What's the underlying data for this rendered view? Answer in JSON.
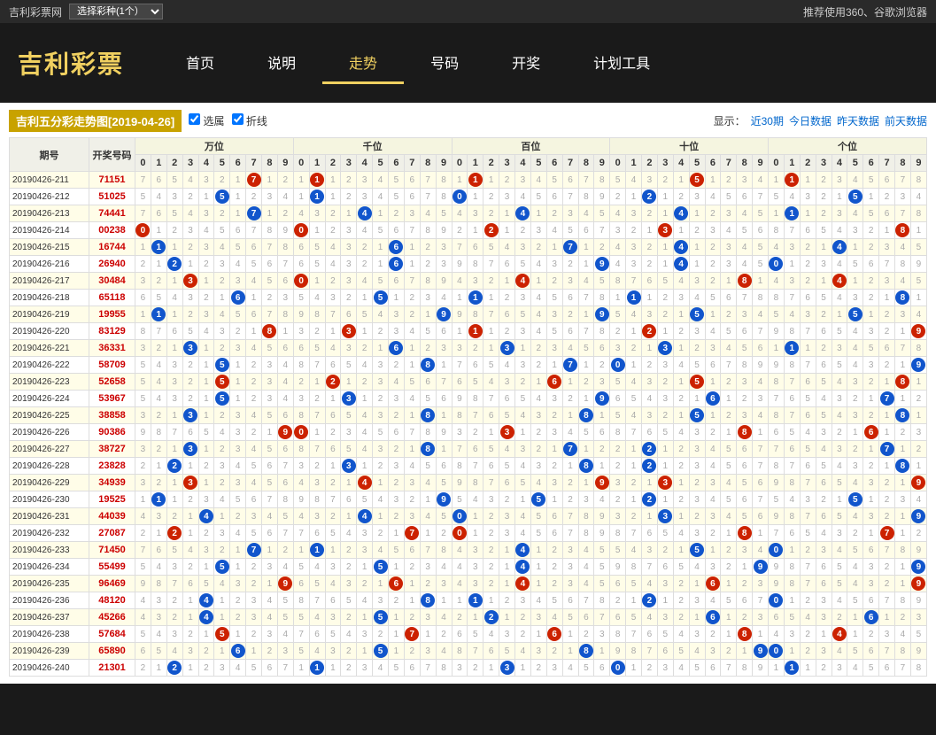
{
  "topbar": {
    "site_link": "吉利彩票网",
    "select_label": "选择彩种(1个）",
    "recommend": "推荐使用360、谷歌浏览器"
  },
  "header": {
    "logo_main": "吉利彩票",
    "nav_items": [
      {
        "label": "首页",
        "active": false
      },
      {
        "label": "说明",
        "active": false
      },
      {
        "label": "走势",
        "active": true
      },
      {
        "label": "号码",
        "active": false
      },
      {
        "label": "开奖",
        "active": false
      },
      {
        "label": "计划工具",
        "active": false
      }
    ]
  },
  "chart": {
    "title": "吉利五分彩走势图[2019-04-26]",
    "checkbox_xuanzhu": "选属",
    "checkbox_zhexian": "折线",
    "display_label": "显示：",
    "links": [
      "近30期",
      "今日数据",
      "昨天数据",
      "前天数据"
    ]
  },
  "table": {
    "headers": {
      "qihao": "期号",
      "kajiang": "开奖号码",
      "wan": "万位",
      "qian": "千位",
      "bai": "百位",
      "shi": "十位",
      "ge": "个位"
    },
    "digits": [
      "0",
      "1",
      "2",
      "3",
      "4",
      "5",
      "6",
      "7",
      "8",
      "9"
    ],
    "rows": [
      {
        "qihao": "20190426-211",
        "kajiang": "71151",
        "wan": "7",
        "qian": "1",
        "bai": "1",
        "shi": "5",
        "ge": "1"
      },
      {
        "qihao": "20190426-212",
        "kajiang": "51025",
        "wan": "5",
        "qian": "1",
        "bai": "0",
        "shi": "2",
        "ge": "5"
      },
      {
        "qihao": "20190426-213",
        "kajiang": "74441",
        "wan": "7",
        "qian": "4",
        "bai": "4",
        "shi": "4",
        "ge": "1"
      },
      {
        "qihao": "20190426-214",
        "kajiang": "00238",
        "wan": "0",
        "qian": "0",
        "bai": "2",
        "shi": "3",
        "ge": "8"
      },
      {
        "qihao": "20190426-215",
        "kajiang": "16744",
        "wan": "1",
        "qian": "6",
        "bai": "7",
        "shi": "4",
        "ge": "4"
      },
      {
        "qihao": "20190426-216",
        "kajiang": "26940",
        "wan": "2",
        "qian": "6",
        "bai": "9",
        "shi": "4",
        "ge": "0"
      },
      {
        "qihao": "20190426-217",
        "kajiang": "30484",
        "wan": "3",
        "qian": "0",
        "bai": "4",
        "shi": "8",
        "ge": "4"
      },
      {
        "qihao": "20190426-218",
        "kajiang": "65118",
        "wan": "6",
        "qian": "5",
        "bai": "1",
        "shi": "1",
        "ge": "8"
      },
      {
        "qihao": "20190426-219",
        "kajiang": "19955",
        "wan": "1",
        "qian": "9",
        "bai": "9",
        "shi": "5",
        "ge": "5"
      },
      {
        "qihao": "20190426-220",
        "kajiang": "83129",
        "wan": "8",
        "qian": "3",
        "bai": "1",
        "shi": "2",
        "ge": "9"
      },
      {
        "qihao": "20190426-221",
        "kajiang": "36331",
        "wan": "3",
        "qian": "6",
        "bai": "3",
        "shi": "3",
        "ge": "1"
      },
      {
        "qihao": "20190426-222",
        "kajiang": "58709",
        "wan": "5",
        "qian": "8",
        "bai": "7",
        "shi": "0",
        "ge": "9"
      },
      {
        "qihao": "20190426-223",
        "kajiang": "52658",
        "wan": "5",
        "qian": "2",
        "bai": "6",
        "shi": "5",
        "ge": "8"
      },
      {
        "qihao": "20190426-224",
        "kajiang": "53967",
        "wan": "5",
        "qian": "3",
        "bai": "9",
        "shi": "6",
        "ge": "7"
      },
      {
        "qihao": "20190426-225",
        "kajiang": "38858",
        "wan": "3",
        "qian": "8",
        "bai": "8",
        "shi": "5",
        "ge": "8"
      },
      {
        "qihao": "20190426-226",
        "kajiang": "90386",
        "wan": "9",
        "qian": "0",
        "bai": "3",
        "shi": "8",
        "ge": "6"
      },
      {
        "qihao": "20190426-227",
        "kajiang": "38727",
        "wan": "3",
        "qian": "8",
        "bai": "7",
        "shi": "2",
        "ge": "7"
      },
      {
        "qihao": "20190426-228",
        "kajiang": "23828",
        "wan": "2",
        "qian": "3",
        "bai": "8",
        "shi": "2",
        "ge": "8"
      },
      {
        "qihao": "20190426-229",
        "kajiang": "34939",
        "wan": "3",
        "qian": "4",
        "bai": "9",
        "shi": "3",
        "ge": "9"
      },
      {
        "qihao": "20190426-230",
        "kajiang": "19525",
        "wan": "1",
        "qian": "9",
        "bai": "5",
        "shi": "2",
        "ge": "5"
      },
      {
        "qihao": "20190426-231",
        "kajiang": "44039",
        "wan": "4",
        "qian": "4",
        "bai": "0",
        "shi": "3",
        "ge": "9"
      },
      {
        "qihao": "20190426-232",
        "kajiang": "27087",
        "wan": "2",
        "qian": "7",
        "bai": "0",
        "shi": "8",
        "ge": "7"
      },
      {
        "qihao": "20190426-233",
        "kajiang": "71450",
        "wan": "7",
        "qian": "1",
        "bai": "4",
        "shi": "5",
        "ge": "0"
      },
      {
        "qihao": "20190426-234",
        "kajiang": "55499",
        "wan": "5",
        "qian": "5",
        "bai": "4",
        "shi": "9",
        "ge": "9"
      },
      {
        "qihao": "20190426-235",
        "kajiang": "96469",
        "wan": "9",
        "qian": "6",
        "bai": "4",
        "shi": "6",
        "ge": "9"
      },
      {
        "qihao": "20190426-236",
        "kajiang": "48120",
        "wan": "4",
        "qian": "8",
        "bai": "1",
        "shi": "2",
        "ge": "0"
      },
      {
        "qihao": "20190426-237",
        "kajiang": "45266",
        "wan": "4",
        "qian": "5",
        "bai": "2",
        "shi": "6",
        "ge": "6"
      },
      {
        "qihao": "20190426-238",
        "kajiang": "57684",
        "wan": "5",
        "qian": "7",
        "bai": "6",
        "shi": "8",
        "ge": "4"
      },
      {
        "qihao": "20190426-239",
        "kajiang": "65890",
        "wan": "6",
        "qian": "5",
        "bai": "8",
        "shi": "9",
        "ge": "0"
      },
      {
        "qihao": "20190426-240",
        "kajiang": "21301",
        "wan": "2",
        "qian": "1",
        "bai": "3",
        "shi": "0",
        "ge": "1"
      }
    ]
  }
}
